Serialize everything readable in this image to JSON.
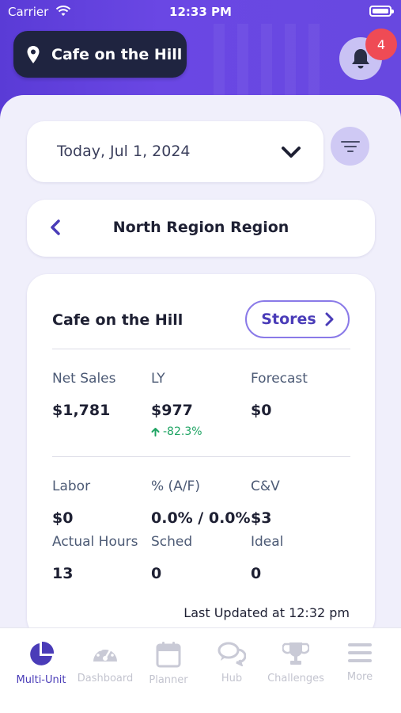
{
  "status_bar": {
    "carrier": "Carrier",
    "time": "12:33 PM"
  },
  "header": {
    "location_name": "Cafe on the Hill",
    "notification_count": "4"
  },
  "date_selector": {
    "label": "Today, Jul 1, 2024"
  },
  "region": {
    "title": "North Region Region"
  },
  "store_card": {
    "store_name": "Cafe on the Hill",
    "stores_button": "Stores",
    "metrics_row1": [
      {
        "label": "Net Sales",
        "value": "$1,781"
      },
      {
        "label": "LY",
        "value": "$977",
        "change": "-82.3%"
      },
      {
        "label": "Forecast",
        "value": "$0"
      }
    ],
    "metrics_row2": [
      {
        "label": "Labor",
        "value": "$0"
      },
      {
        "label": "% (A/F)",
        "value": "0.0% / 0.0%"
      },
      {
        "label": "C&V",
        "value": "$3"
      }
    ],
    "metrics_row3": [
      {
        "label": "Actual Hours",
        "value": "13"
      },
      {
        "label": "Sched",
        "value": "0"
      },
      {
        "label": "Ideal",
        "value": "0"
      }
    ],
    "last_updated": "Last Updated at 12:32 pm"
  },
  "tab_bar": {
    "tabs": [
      {
        "label": "Multi-Unit",
        "icon": "pie-chart-icon",
        "active": true
      },
      {
        "label": "Dashboard",
        "icon": "speedometer-icon",
        "active": false
      },
      {
        "label": "Planner",
        "icon": "calendar-icon",
        "active": false
      },
      {
        "label": "Hub",
        "icon": "chat-bubbles-icon",
        "active": false
      },
      {
        "label": "Challenges",
        "icon": "trophy-icon",
        "active": false
      },
      {
        "label": "More",
        "icon": "menu-icon",
        "active": false
      }
    ]
  },
  "colors": {
    "accent": "#4a3cb8",
    "header": "#6548e0",
    "badge": "#ef4b55",
    "positive": "#1fa463"
  }
}
